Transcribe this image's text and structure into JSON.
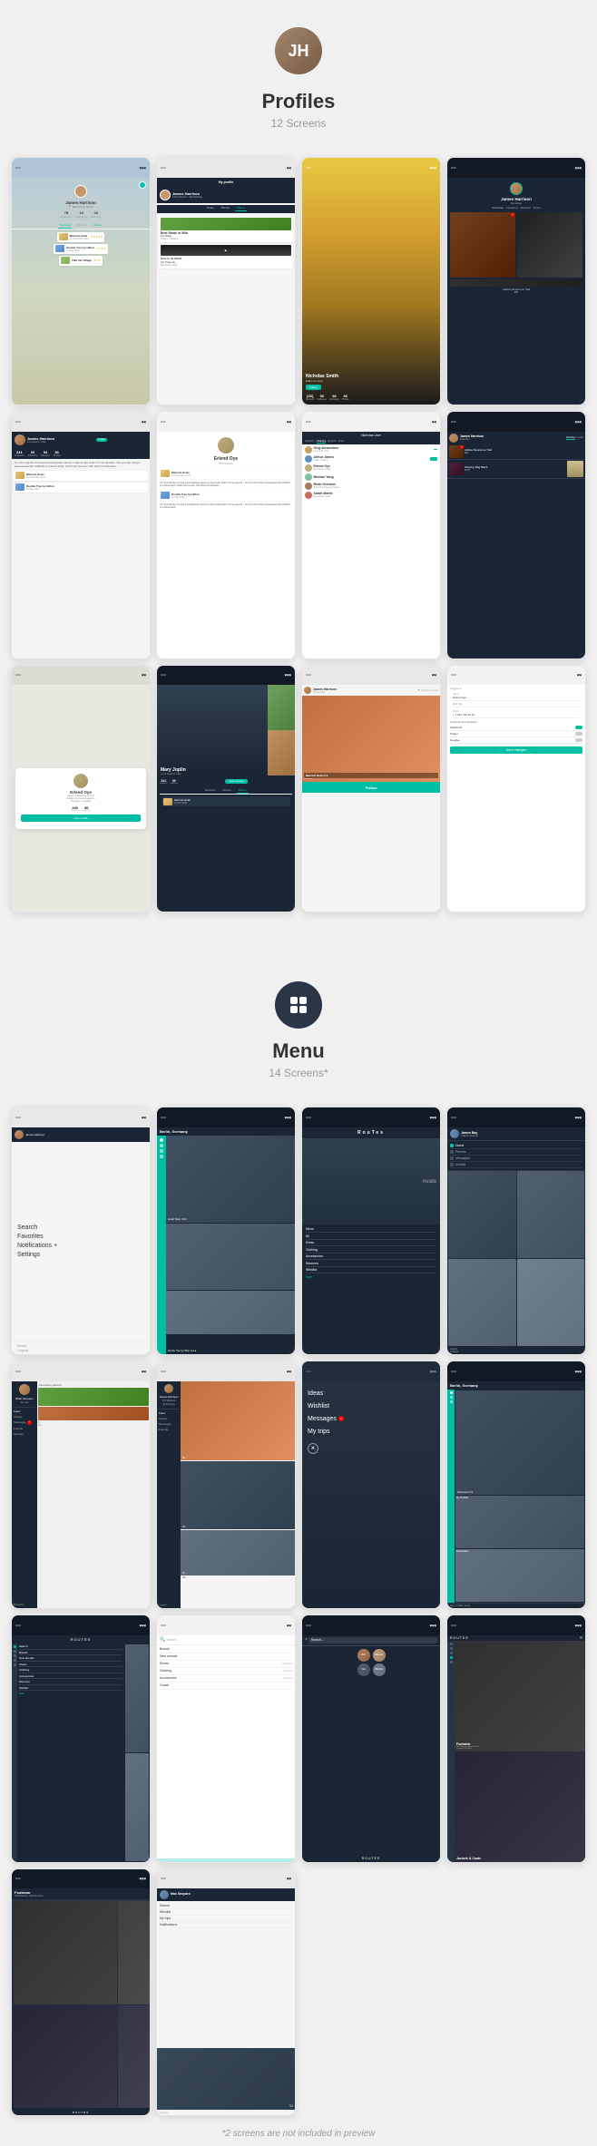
{
  "profiles_section": {
    "avatar_initials": "JH",
    "title": "Profiles",
    "subtitle": "12 Screens",
    "screens": [
      {
        "id": "p1",
        "type": "profile_map",
        "name": "James Harrison",
        "location": "Barcelona, Spain"
      },
      {
        "id": "p2",
        "type": "profile_posts",
        "name": "James Harrison",
        "tabs": [
          "Posts",
          "Photos",
          "Places"
        ]
      },
      {
        "id": "p3",
        "type": "profile_person",
        "name": "Nicholas Smith",
        "role": "Editor-in-chief"
      },
      {
        "id": "p4",
        "type": "profile_dark",
        "name": "James Harrison"
      },
      {
        "id": "p5",
        "type": "profile_followers",
        "name": "James Harrison",
        "location": "Los Angeles, USA"
      },
      {
        "id": "p6",
        "type": "profile_following",
        "name": "Erlend Oye"
      },
      {
        "id": "p7",
        "type": "profile_following_list",
        "people": [
          "Oleg Alexandrov",
          "Arthur James",
          "Erlend Oye",
          "Michael Yang",
          "Brian Grenson",
          "Sarah Martin"
        ]
      },
      {
        "id": "p8",
        "type": "profile_products"
      },
      {
        "id": "p9",
        "type": "profile_white_card",
        "name": "Erlend Oye"
      },
      {
        "id": "p10",
        "type": "profile_dark_person",
        "name": "Mary Joplin"
      },
      {
        "id": "p11",
        "type": "profile_review",
        "name": "James Harrison"
      },
      {
        "id": "p12",
        "type": "profile_settings",
        "name": "Erlend Oye"
      }
    ]
  },
  "menu_section": {
    "title": "Menu",
    "subtitle": "14 Screens*",
    "screens": [
      {
        "id": "m1",
        "type": "menu_list",
        "items": [
          "Search",
          "Favorites",
          "Notifications +",
          "Settings"
        ]
      },
      {
        "id": "m2",
        "type": "menu_sidebar_dark",
        "city": "Berlin, Germany"
      },
      {
        "id": "m3",
        "type": "menu_routes",
        "title": "ROUTES",
        "items": [
          "Menu",
          "All",
          "Dress",
          "Clothing",
          "Accessories",
          "Womens",
          "Wishlist",
          "Sale"
        ]
      },
      {
        "id": "m4",
        "type": "menu_user_dark",
        "name": "James Bay"
      },
      {
        "id": "m5",
        "type": "menu_sidebar_profile",
        "name": "Brian Grenson"
      },
      {
        "id": "m6",
        "type": "menu_profile_tabs",
        "name": "James Harrison"
      },
      {
        "id": "m7",
        "type": "menu_overlay_list",
        "items": [
          "Ideas",
          "Wishlist",
          "Messages",
          "My trips"
        ]
      },
      {
        "id": "m8",
        "type": "menu_city_dark",
        "city": "Berlin, Germany"
      },
      {
        "id": "m9",
        "type": "menu_routes_dark",
        "title": "ROUTES"
      },
      {
        "id": "m10",
        "type": "menu_search_list",
        "items": [
          "Brands",
          "New arrivals",
          "Shoes",
          "Clothing",
          "Accessories"
        ]
      },
      {
        "id": "m11",
        "type": "menu_search_overlay"
      },
      {
        "id": "m12",
        "type": "menu_footwear",
        "items": [
          "Footwear",
          "Jackets & Coats"
        ]
      },
      {
        "id": "m13",
        "type": "menu_footwear_dark",
        "title": "Footwear"
      },
      {
        "id": "m14",
        "type": "menu_user_settings",
        "name": "Max Shepard"
      }
    ]
  },
  "bottom_note": "*2 screens are not included in preview",
  "people": {
    "james_harrison": "James Harrison",
    "nicholas_smith": "Nicholas Smith",
    "erlend_oye": "Erlend Oye",
    "mary_joplin": "Mary Joplin",
    "oleg_alexandrov": "Oleg Alexandrov",
    "arthur_james": "Arthur James",
    "michael_yang": "Michael Yang",
    "brian_grenson": "Brian Grenson",
    "sarah_martin": "Sarah Martin",
    "james_bay": "James Bay"
  },
  "routes_title": "RouTes",
  "search_label": "Search",
  "footwear_label": "Footwear",
  "jackets_label": "Jackets & Coats"
}
